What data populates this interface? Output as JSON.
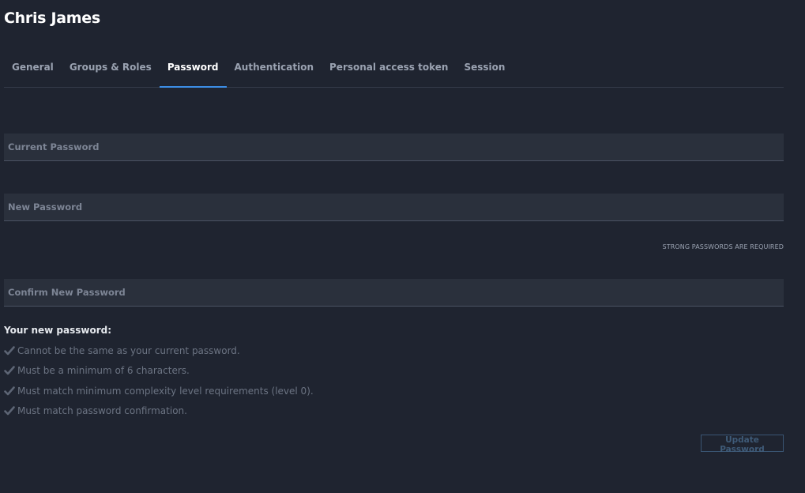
{
  "page": {
    "title": "Chris James"
  },
  "tabs": [
    {
      "label": "General",
      "active": false
    },
    {
      "label": "Groups & Roles",
      "active": false
    },
    {
      "label": "Password",
      "active": true
    },
    {
      "label": "Authentication",
      "active": false
    },
    {
      "label": "Personal access token",
      "active": false
    },
    {
      "label": "Session",
      "active": false
    }
  ],
  "form": {
    "current_password": {
      "label": "Current Password",
      "value": ""
    },
    "new_password": {
      "label": "New Password",
      "value": ""
    },
    "strength_hint": "STRONG PASSWORDS ARE REQUIRED",
    "confirm_password": {
      "label": "Confirm New Password",
      "value": ""
    }
  },
  "requirements": {
    "title": "Your new password:",
    "items": [
      "Cannot be the same as your current password.",
      "Must be a minimum of 6 characters.",
      "Must match minimum complexity level requirements (level 0).",
      "Must match password confirmation."
    ],
    "icon": "checkmark-icon"
  },
  "actions": {
    "update_label": "Update Password"
  },
  "colors": {
    "background": "#1f2430",
    "field_background": "#2a303c",
    "accent": "#3c8ee6",
    "disabled_button": "#3f5b78"
  }
}
